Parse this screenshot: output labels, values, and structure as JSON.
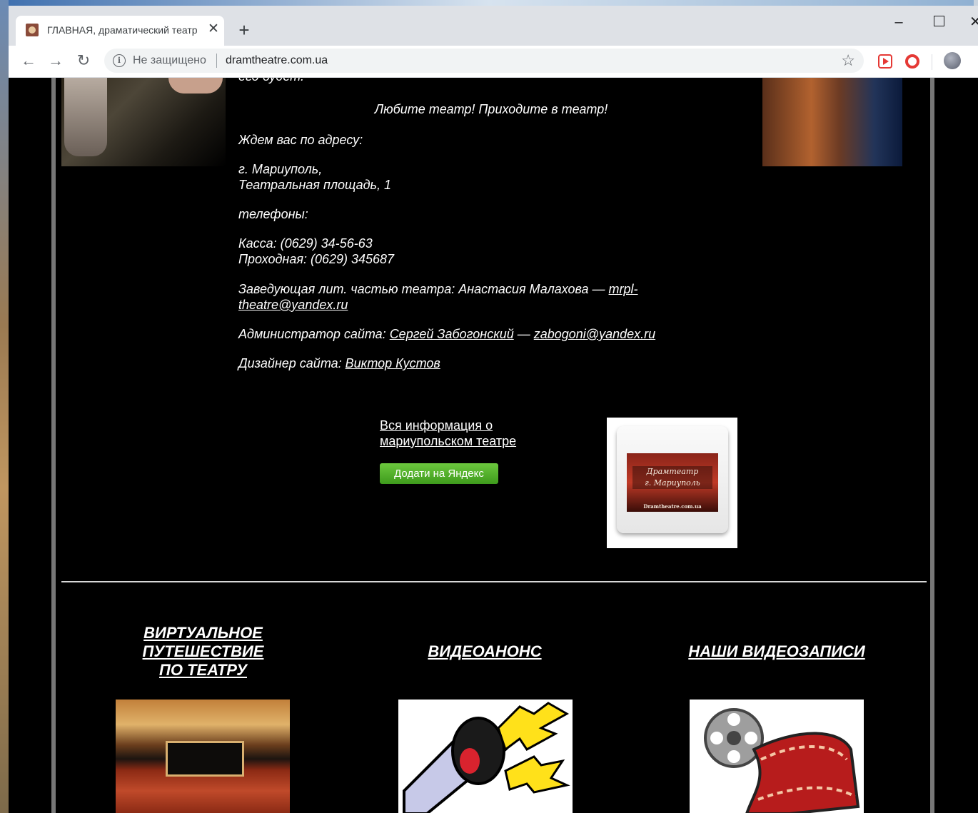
{
  "browser": {
    "tab_title": "ГЛАВНАЯ, драматический театр",
    "tab_close": "✕",
    "new_tab": "+",
    "security_label": "Не защищено",
    "url": "dramtheatre.com.ua",
    "window_controls": {
      "minimize": "–",
      "close": "✕"
    }
  },
  "content": {
    "cut_line": "его будет.",
    "motto": "Любите театр! Приходите в театр!",
    "address_intro": "Ждем вас по адресу:",
    "address_line1": "г. Мариуполь,",
    "address_line2": "Театральная площадь, 1",
    "phones_label": "телефоны:",
    "phone_box": "Касса: (0629) 34-56-63",
    "phone_gate": "Проходная: (0629) 345687",
    "lit_label": "Заведующая лит. частью театра: Анастасия Малахова — ",
    "lit_email_part1": "mrpl-",
    "lit_email_part2": "theatre@yandex.ru",
    "admin_label": "Администратор сайта: ",
    "admin_name": "Сергей Забогонский",
    "admin_dash": " — ",
    "admin_email": "zabogoni@yandex.ru",
    "designer_label": "Дизайнер сайта: ",
    "designer_name": "Виктор Кустов",
    "info_link": "Вся информация о мариупольском театре",
    "yandex_button": "Додати на Яндекс",
    "badge_title_line1": "Драмтеатр",
    "badge_title_line2": "г. Мариуполь",
    "badge_domain": "Dramtheatre.com.ua"
  },
  "sections": [
    {
      "title_lines": [
        "ВИРТУАЛЬНОЕ",
        "ПУТЕШЕСТВИЕ",
        "ПО ТЕАТРУ"
      ]
    },
    {
      "title": "ВИДЕОАНОНС"
    },
    {
      "title": "НАШИ ВИДЕОЗАПИСИ"
    }
  ],
  "colors": {
    "page_bg": "#000000",
    "text": "#ffffff",
    "button_green": "#4caf26",
    "frame_gray": "#777777"
  },
  "icons": [
    "back-icon",
    "forward-icon",
    "reload-icon",
    "info-icon",
    "star-icon",
    "megaphone-icon",
    "film-reel-icon"
  ]
}
